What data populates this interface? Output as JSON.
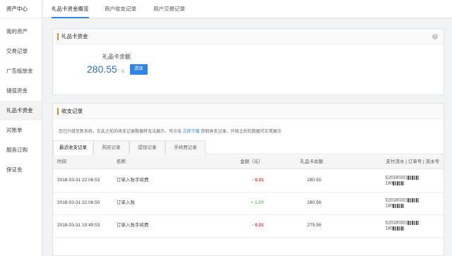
{
  "sidebar": {
    "title": "资产中心",
    "items": [
      {
        "label": "我的资产"
      },
      {
        "label": "交易记录"
      },
      {
        "label": "广告投放金"
      },
      {
        "label": "储值资金"
      },
      {
        "label": "礼品卡资金"
      },
      {
        "label": "对账单"
      },
      {
        "label": "服务订购"
      },
      {
        "label": "保证金"
      }
    ],
    "active_index": 4
  },
  "topnav": {
    "tabs": [
      {
        "label": "礼品卡资金概览"
      },
      {
        "label": "商户收支记录"
      },
      {
        "label": "用户交易记录"
      }
    ],
    "active_index": 0
  },
  "overview": {
    "title": "礼品卡资金",
    "balance_label": "礼品卡余额",
    "balance_value": "280.55",
    "balance_unit": "元",
    "withdraw_label": "提现",
    "help_icon": "?"
  },
  "records": {
    "title": "收支记录",
    "notice_prefix": "您已升级至新系统，在此之前的收支记录数据将无法展示，可点击",
    "notice_link": "立即下载",
    "notice_suffix": "获取收支记录。升级之后的数据可正常展示",
    "subtabs": [
      {
        "label": "最近收支记录"
      },
      {
        "label": "购买记录"
      },
      {
        "label": "提现记录"
      },
      {
        "label": "手续费记录"
      }
    ],
    "active_subtab": 0,
    "columns": {
      "time": "时间",
      "name": "名称",
      "amount": "金额（元）",
      "balance": "礼品卡余额",
      "ref": "支付流水 | 订单号 | 流水号"
    },
    "rows": [
      {
        "time": "2018-03-31 22:06:53",
        "name": "订单入账手续费",
        "amount": "- 0.01",
        "balance": "280.55",
        "ref_line1": "E20180331",
        "ref_line2": "180"
      },
      {
        "time": "2018-03-31 22:06:50",
        "name": "订单入账",
        "amount": "+ 1.00",
        "balance": "280.56",
        "ref_line1": "E20180331",
        "ref_line2": "180"
      },
      {
        "time": "2018-03-31 19:49:53",
        "name": "订单入账手续费",
        "amount": "- 0.01",
        "balance": "279.56",
        "ref_line1": "E20180331",
        "ref_line2": "180"
      }
    ]
  },
  "colors": {
    "accent_blue": "#2f86e8",
    "accent_orange": "#f08a24",
    "negative": "#e0362f",
    "positive": "#3cae3c"
  }
}
